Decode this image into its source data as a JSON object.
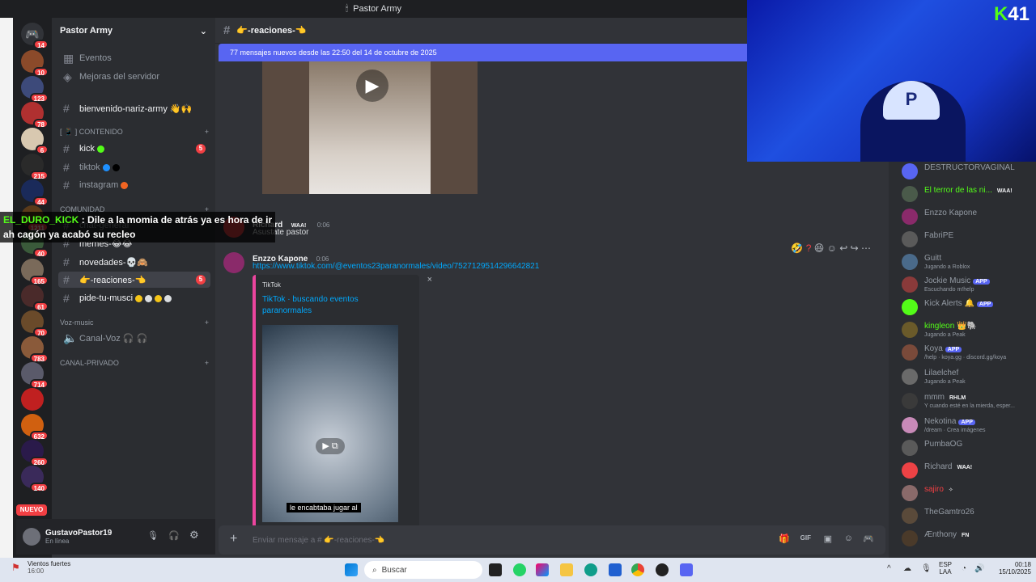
{
  "window": {
    "title": "Pastor Army"
  },
  "server": {
    "name": "Pastor Army",
    "top_items": [
      {
        "label": "Eventos"
      },
      {
        "label": "Mejoras del servidor"
      }
    ],
    "rail_badges": [
      "14",
      "10",
      "123",
      "78",
      "6",
      "215",
      "44",
      "1211",
      "40",
      "165",
      "61",
      "70",
      "783",
      "714",
      "",
      "632",
      "260",
      "140"
    ],
    "nuevo_label": "NUEVO"
  },
  "channels": {
    "welcome": "bienvenido-nariz-army 👋🙌",
    "cat_contenido": "[ 📱 ] CONTENIDO",
    "kick": "kick",
    "kick_badge": "5",
    "tiktok": "tiktok",
    "instagram": "instagram",
    "cat_comunidad": "COMUNIDAD",
    "chat_general": "chat-general",
    "memes": "memes-😂😂",
    "novedades": "novedades-💀🙈",
    "reacciones": "👉-reaciones-👈",
    "reacciones_badge": "5",
    "pide": "pide-tu-musci",
    "cat_voz": "Voz-music",
    "canal_voz": "Canal-Voz 🎧 🎧",
    "cat_privado": "CANAL-PRIVADO"
  },
  "user": {
    "name": "GustavoPastor19",
    "status": "En línea"
  },
  "overlay": {
    "line1_user": "EL_DURO_KICK",
    "line1_text": " : Dile a la momia de atrás ya es hora de ir",
    "line2": "ah cagón ya acabó su recleo"
  },
  "main": {
    "channel_title": "👉-reaciones-👈",
    "new_messages": "77 mensajes nuevos desde las 22:50 del 14 de octubre de 2025",
    "msg1": {
      "author": "Richard",
      "tag": "WAA!",
      "time": "0:06",
      "text": "Asustate pastor"
    },
    "msg2": {
      "author": "Enzzo Kapone",
      "time": "0:06",
      "link": "https://www.tiktok.com/@eventos23paranormales/video/7527129514296642821",
      "embed_provider": "TikTok",
      "embed_title": "TikTok · buscando  eventos paranormales",
      "subtitle": "le encabtaba jugar al"
    },
    "composer_placeholder": "Enviar mensaje a # 👉-reaciones-👈"
  },
  "members": [
    {
      "name": "DESTRUCTORVAGINAL",
      "status": "",
      "tag": ""
    },
    {
      "name": "El terror de las ni...",
      "status": "",
      "tag": "WAA!"
    },
    {
      "name": "Enzzo Kapone",
      "status": "",
      "tag": ""
    },
    {
      "name": "FabriPE",
      "status": "",
      "tag": ""
    },
    {
      "name": "Guitt",
      "status": "Jugando a Roblox",
      "tag": ""
    },
    {
      "name": "Jockie Music",
      "status": "Escuchando m!help",
      "tag": "APP"
    },
    {
      "name": "Kick Alerts 🔔",
      "status": "",
      "tag": "APP"
    },
    {
      "name": "kingleon 👑🐘",
      "status": "Jugando a Peak",
      "tag": ""
    },
    {
      "name": "Koya",
      "status": "/help · koya.gg · discord.gg/koya",
      "tag": "APP"
    },
    {
      "name": "Lilaelchef",
      "status": "Jugando a Peak",
      "tag": ""
    },
    {
      "name": "mmm",
      "status": "Y cuando esté en la mierda, esper...",
      "tag": "RHLM"
    },
    {
      "name": "Nekotina",
      "status": "/dream · Crea imágenes",
      "tag": "APP"
    },
    {
      "name": "PumbaOG",
      "status": "",
      "tag": ""
    },
    {
      "name": "Richard",
      "status": "",
      "tag": "WAA!"
    },
    {
      "name": "sajiro",
      "status": "",
      "tag": "✧ ㅤㅤ"
    },
    {
      "name": "TheGamtro26",
      "status": "",
      "tag": ""
    },
    {
      "name": "Ænthony",
      "status": "",
      "tag": "FN"
    }
  ],
  "stream": {
    "logo_k": "K",
    "logo_num": "41"
  },
  "taskbar": {
    "weather_title": "Vientos fuertes",
    "weather_time": "16:00",
    "search": "Buscar",
    "lang1": "ESP",
    "lang2": "LAA",
    "time": "00:18",
    "date": "15/10/2025"
  }
}
